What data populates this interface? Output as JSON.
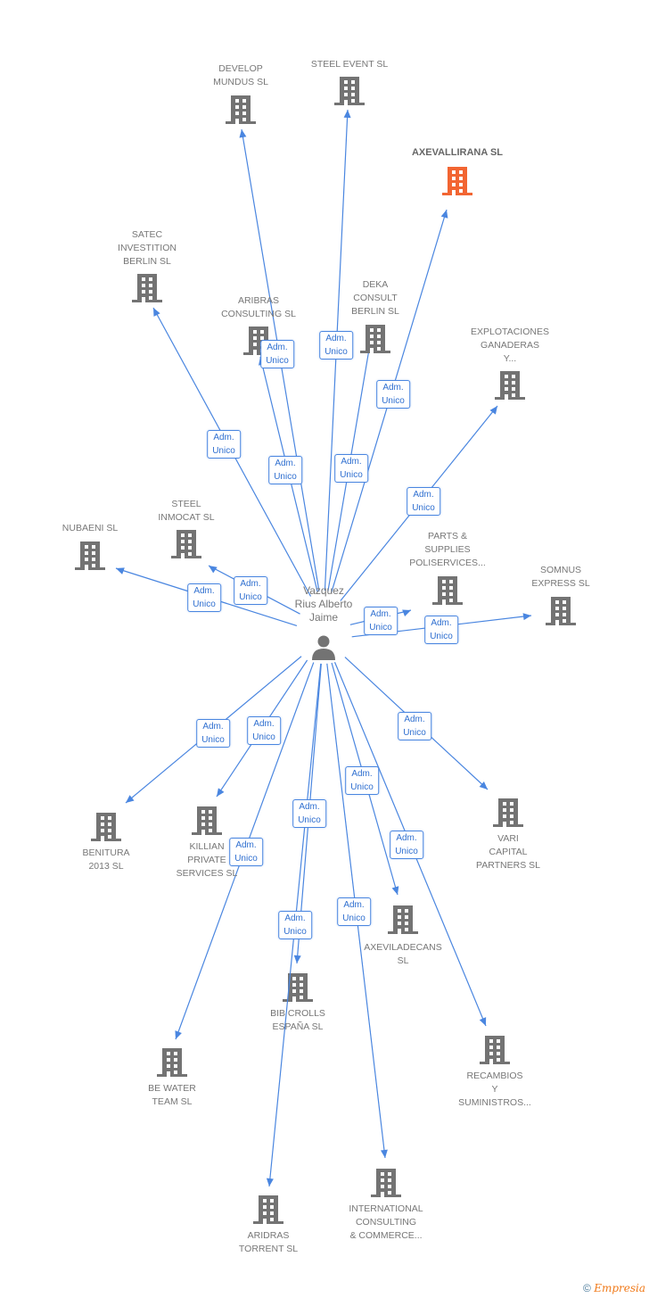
{
  "center": {
    "name": "Vazquez Rius Alberto Jaime",
    "name_lines": [
      "Vazquez",
      "Rius Alberto",
      "Jaime"
    ],
    "icon": "person-icon"
  },
  "colors": {
    "edge": "#4a86e0",
    "node": "#737373",
    "highlight": "#f26532"
  },
  "nodes": [
    {
      "lines": [
        "DEVELOP",
        "MUNDUS SL"
      ],
      "role": "Adm. Unico"
    },
    {
      "lines": [
        "STEEL EVENT SL"
      ],
      "role": "Adm. Unico"
    },
    {
      "lines": [
        "AXEVALLIRANA SL"
      ],
      "role": "Adm. Unico",
      "highlight": true
    },
    {
      "lines": [
        "SATEC",
        "INVESTITION",
        "BERLIN  SL"
      ],
      "role": "Adm. Unico"
    },
    {
      "lines": [
        "ARIBRAS",
        "CONSULTING SL"
      ],
      "role": "Adm. Unico"
    },
    {
      "lines": [
        "DEKA",
        "CONSULT",
        "BERLIN  SL"
      ],
      "role": "Adm. Unico"
    },
    {
      "lines": [
        "EXPLOTACIONES",
        "GANADERAS",
        "Y..."
      ],
      "role": "Adm. Unico"
    },
    {
      "lines": [
        "STEEL",
        "INMOCAT SL"
      ],
      "role": "Adm. Unico"
    },
    {
      "lines": [
        "NUBAENI SL"
      ],
      "role": "Adm. Unico"
    },
    {
      "lines": [
        "PARTS &",
        "SUPPLIES",
        "POLISERVICES..."
      ],
      "role": "Adm. Unico"
    },
    {
      "lines": [
        "SOMNUS",
        "EXPRESS SL"
      ],
      "role": "Adm. Unico"
    },
    {
      "lines": [
        "BENITURA",
        "2013 SL"
      ],
      "role": "Adm. Unico"
    },
    {
      "lines": [
        "KILLIAN",
        "PRIVATE",
        "SERVICES  SL"
      ],
      "role": "Adm. Unico"
    },
    {
      "lines": [
        "BE WATER",
        "TEAM  SL"
      ],
      "role": "Adm. Unico"
    },
    {
      "lines": [
        "BIB CROLLS",
        "ESPAÑA  SL"
      ],
      "role": "Adm. Unico"
    },
    {
      "lines": [
        "AXEVILADECANS",
        "SL"
      ],
      "role": "Adm. Unico"
    },
    {
      "lines": [
        "VARI",
        "CAPITAL",
        "PARTNERS  SL"
      ],
      "role": "Adm. Unico"
    },
    {
      "lines": [
        "RECAMBIOS",
        "Y",
        "SUMINISTROS..."
      ],
      "role": "Adm. Unico"
    },
    {
      "lines": [
        "INTERNATIONAL",
        "CONSULTING",
        "& COMMERCE..."
      ],
      "role": "Adm. Unico"
    },
    {
      "lines": [
        "ARIDRAS",
        "TORRENT  SL"
      ],
      "role": "Adm. Unico"
    }
  ],
  "footer": {
    "copyright": "©",
    "brand": "Empresia"
  }
}
